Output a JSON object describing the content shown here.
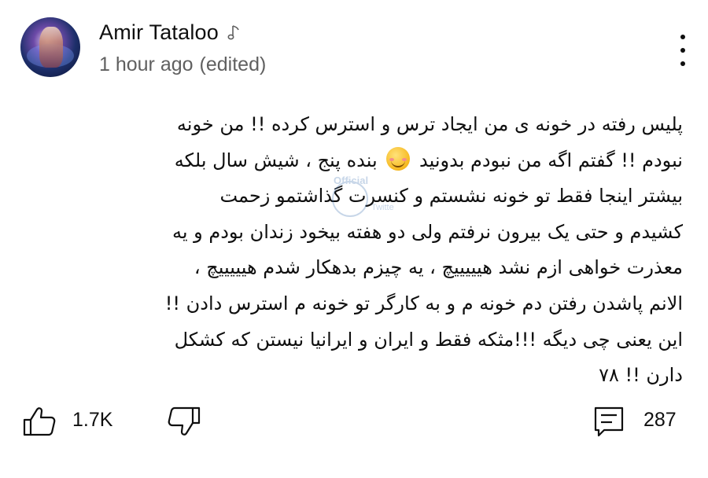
{
  "author": {
    "name": "Amir Tataloo",
    "badge_icon": "music-note-icon",
    "avatar_icon": "avatar"
  },
  "meta": {
    "time": "1 hour ago",
    "edited": "(edited)"
  },
  "menu_icon": "more-vertical-icon",
  "comment": {
    "lines": [
      {
        "before": "پلیس  رفته در خونه ی من ایجاد ترس و استرس کرده !! من خونه",
        "after": ""
      },
      {
        "before": "نبودم !! گفتم اگه من نبودم بدونید",
        "emoji": "smiling-blush-emoji",
        "after": "بنده پنج ، شیش سال بلکه"
      },
      {
        "before": "بیشتر اینجا فقط تو خونه نشستم و کنسرت گذاشتمو زحمت",
        "after": ""
      },
      {
        "before": "کشیدم و حتی یک بیرون نرفتم ولی دو هفته بیخود زندان بودم و یه",
        "after": ""
      },
      {
        "before": "معذرت خواهی ازم نشد هیییییچ ، یه چیزم بدهکار شدم هیییییچ ،",
        "after": ""
      },
      {
        "before": "الانم پاشدن رفتن دم خونه م و به کارگر تو خونه م استرس دادن !!",
        "after": ""
      },
      {
        "before": "این یعنی چی دیگه !!!مثکه فقط و ایران و ایرانیا نیستن که کشکل",
        "after": ""
      },
      {
        "before": "دارن !! ۷۸",
        "after": ""
      }
    ]
  },
  "watermark": {
    "line1": "Official",
    "line2": "Twitte"
  },
  "actions": {
    "like_icon": "thumbs-up-icon",
    "like_count": "1.7K",
    "dislike_icon": "thumbs-down-icon",
    "reply_icon": "comment-icon",
    "reply_count": "287"
  },
  "colors": {
    "text": "#0f0f0f",
    "meta": "#606060",
    "background": "#ffffff"
  }
}
